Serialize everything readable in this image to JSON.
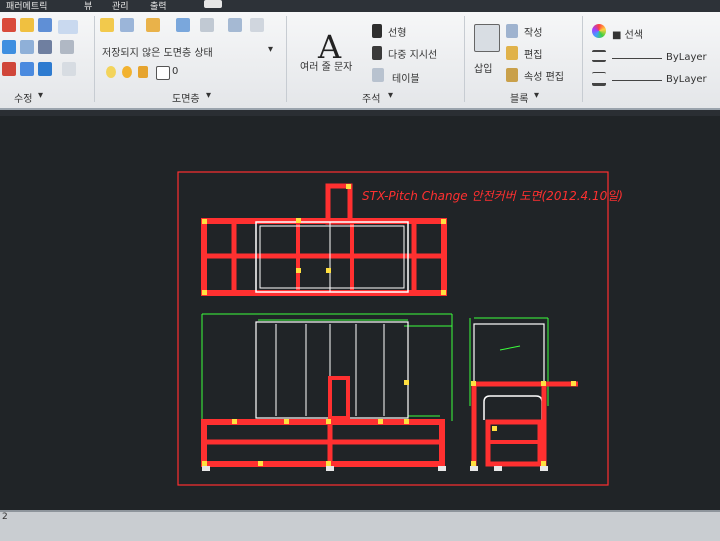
{
  "menu": [
    "패러메트릭",
    "뷰",
    "관리",
    "출력"
  ],
  "ribbon": {
    "modify": {
      "title": "수정",
      "arrow": "▾"
    },
    "layers": {
      "title": "도면층",
      "state_label": "저장되지 않은 도면층 상태",
      "layer_value": "0",
      "arrow": "▾"
    },
    "annotation": {
      "title": "주석",
      "text_button": "여러 줄 문자",
      "linear": "선형",
      "multileader": "다중 지시선",
      "table": "테이블",
      "arrow": "▾",
      "glyph": "A"
    },
    "block": {
      "title": "블록",
      "insert": "삽입",
      "create": "작성",
      "edit": "편집",
      "attribute_edit": "속성 편집",
      "arrow": "▾"
    },
    "properties": {
      "color": "■ 선색",
      "linetype": "ByLayer",
      "lineweight": "ByLayer"
    }
  },
  "drawing": {
    "title": "STX-Pitch Change 안전커버 도면(2012.4.10일)",
    "accent": "#ff2a2a",
    "frame_color": "#ff3030",
    "panel_color": "#ffffff",
    "dim_color": "#3cff3c"
  },
  "cmdline": {
    "coord": "2"
  }
}
